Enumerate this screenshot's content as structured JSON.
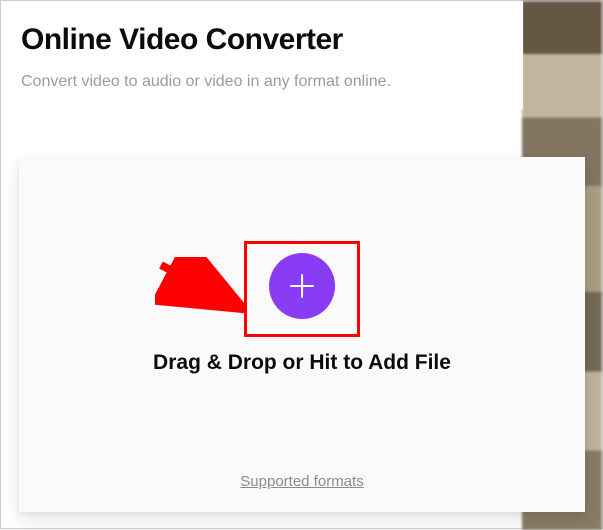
{
  "header": {
    "title": "Online Video Converter",
    "subtitle": "Convert video to audio or video in any format online."
  },
  "dropzone": {
    "cta": "Drag & Drop or Hit to Add File",
    "supported_link": "Supported formats"
  },
  "colors": {
    "accent": "#8a3cf5",
    "annotation": "#ff0000"
  }
}
